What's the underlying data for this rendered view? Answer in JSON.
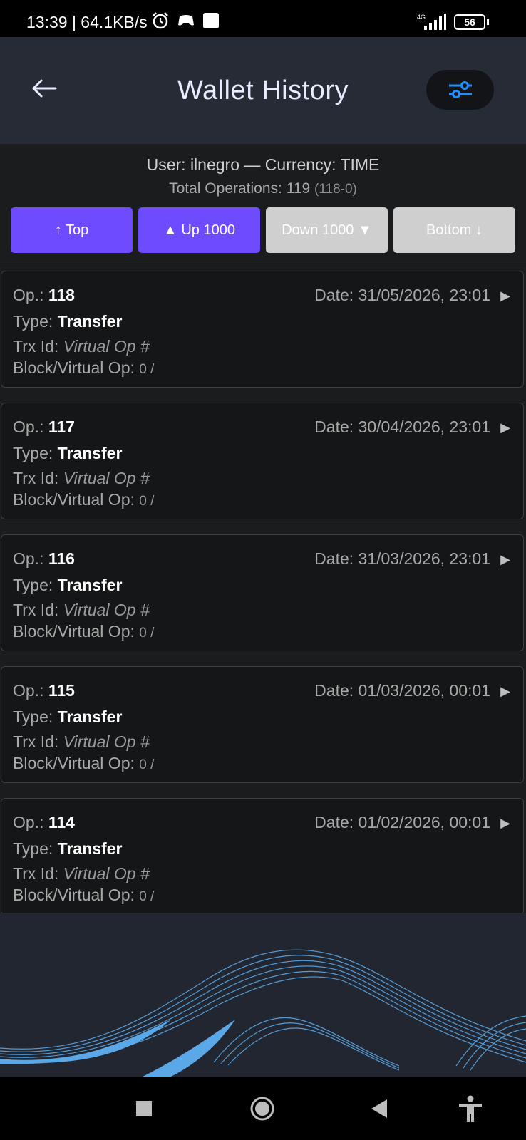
{
  "status": {
    "time_speed": "13:39 | 64.1KB/s",
    "network": "4G",
    "battery": "56"
  },
  "header": {
    "title": "Wallet History"
  },
  "info": {
    "user_line": "User: ilnegro — Currency: TIME",
    "total_line": "Total Operations: 119",
    "total_range": "(118-0)"
  },
  "nav_buttons": {
    "top": "↑ Top",
    "up": "▲ Up 1000",
    "down": "Down 1000 ▼",
    "bottom": "Bottom ↓"
  },
  "labels": {
    "op": "Op.:",
    "type": "Type:",
    "trx": "Trx Id:",
    "block": "Block/Virtual Op:",
    "date": "Date:"
  },
  "operations": [
    {
      "op": "118",
      "date": "31/05/2026, 23:01",
      "type": "Transfer",
      "trx": "Virtual Op #",
      "block": "0 /"
    },
    {
      "op": "117",
      "date": "30/04/2026, 23:01",
      "type": "Transfer",
      "trx": "Virtual Op #",
      "block": "0 /"
    },
    {
      "op": "116",
      "date": "31/03/2026, 23:01",
      "type": "Transfer",
      "trx": "Virtual Op #",
      "block": "0 /"
    },
    {
      "op": "115",
      "date": "01/03/2026, 00:01",
      "type": "Transfer",
      "trx": "Virtual Op #",
      "block": "0 /"
    },
    {
      "op": "114",
      "date": "01/02/2026, 00:01",
      "type": "Transfer",
      "trx": "Virtual Op #",
      "block": "0 /"
    }
  ],
  "colors": {
    "accent": "#6f4bff",
    "filter_icon": "#1e90ff",
    "wave": "#5aa8e8"
  },
  "icons": {
    "back": "arrow-left-icon",
    "filter": "sliders-icon",
    "row_arrow": "play-right-icon"
  }
}
